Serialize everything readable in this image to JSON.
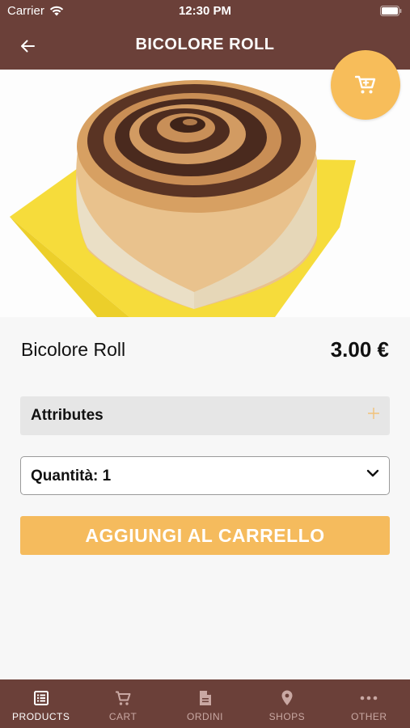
{
  "status_bar": {
    "carrier": "Carrier",
    "time": "12:30 PM"
  },
  "nav": {
    "title": "BICOLORE ROLL"
  },
  "product": {
    "name": "Bicolore Roll",
    "price": "3.00 €",
    "image_count": 1,
    "current_image": 1
  },
  "attributes": {
    "label": "Attributes"
  },
  "quantity": {
    "label": "Quantità: 1"
  },
  "add_button": {
    "label": "AGGIUNGI AL CARRELLO"
  },
  "tabs": [
    {
      "label": "PRODUCTS",
      "icon": "list-icon",
      "active": true
    },
    {
      "label": "CART",
      "icon": "cart-icon",
      "active": false
    },
    {
      "label": "ORDINI",
      "icon": "document-icon",
      "active": false
    },
    {
      "label": "SHOPS",
      "icon": "map-pin-icon",
      "active": false
    },
    {
      "label": "OTHER",
      "icon": "more-icon",
      "active": false
    }
  ],
  "colors": {
    "header_brown": "#6b4039",
    "accent_orange": "#f5bb5d",
    "tab_inactive": "#c9a8a3"
  }
}
